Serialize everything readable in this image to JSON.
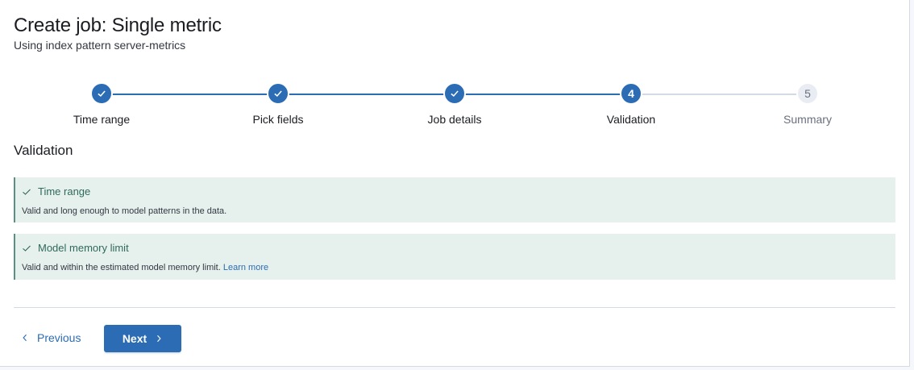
{
  "header": {
    "title": "Create job: Single metric",
    "subtitle": "Using index pattern server-metrics"
  },
  "stepper": {
    "steps": [
      {
        "label": "Time range",
        "status": "complete",
        "number": "1"
      },
      {
        "label": "Pick fields",
        "status": "complete",
        "number": "2"
      },
      {
        "label": "Job details",
        "status": "complete",
        "number": "3"
      },
      {
        "label": "Validation",
        "status": "current",
        "number": "4"
      },
      {
        "label": "Summary",
        "status": "incomplete",
        "number": "5"
      }
    ]
  },
  "section": {
    "title": "Validation"
  },
  "callouts": [
    {
      "title": "Time range",
      "body": "Valid and long enough to model patterns in the data.",
      "link": ""
    },
    {
      "title": "Model memory limit",
      "body": "Valid and within the estimated model memory limit. ",
      "link": "Learn more"
    }
  ],
  "footer": {
    "previous_label": "Previous",
    "next_label": "Next"
  },
  "colors": {
    "primary": "#2b6cb4",
    "success_bg": "#e6f1ee",
    "success_text": "#2f6a5a"
  },
  "icons": {
    "step_complete": "check-icon",
    "callout": "check-icon",
    "previous": "chevron-left-icon",
    "next": "chevron-right-icon"
  }
}
